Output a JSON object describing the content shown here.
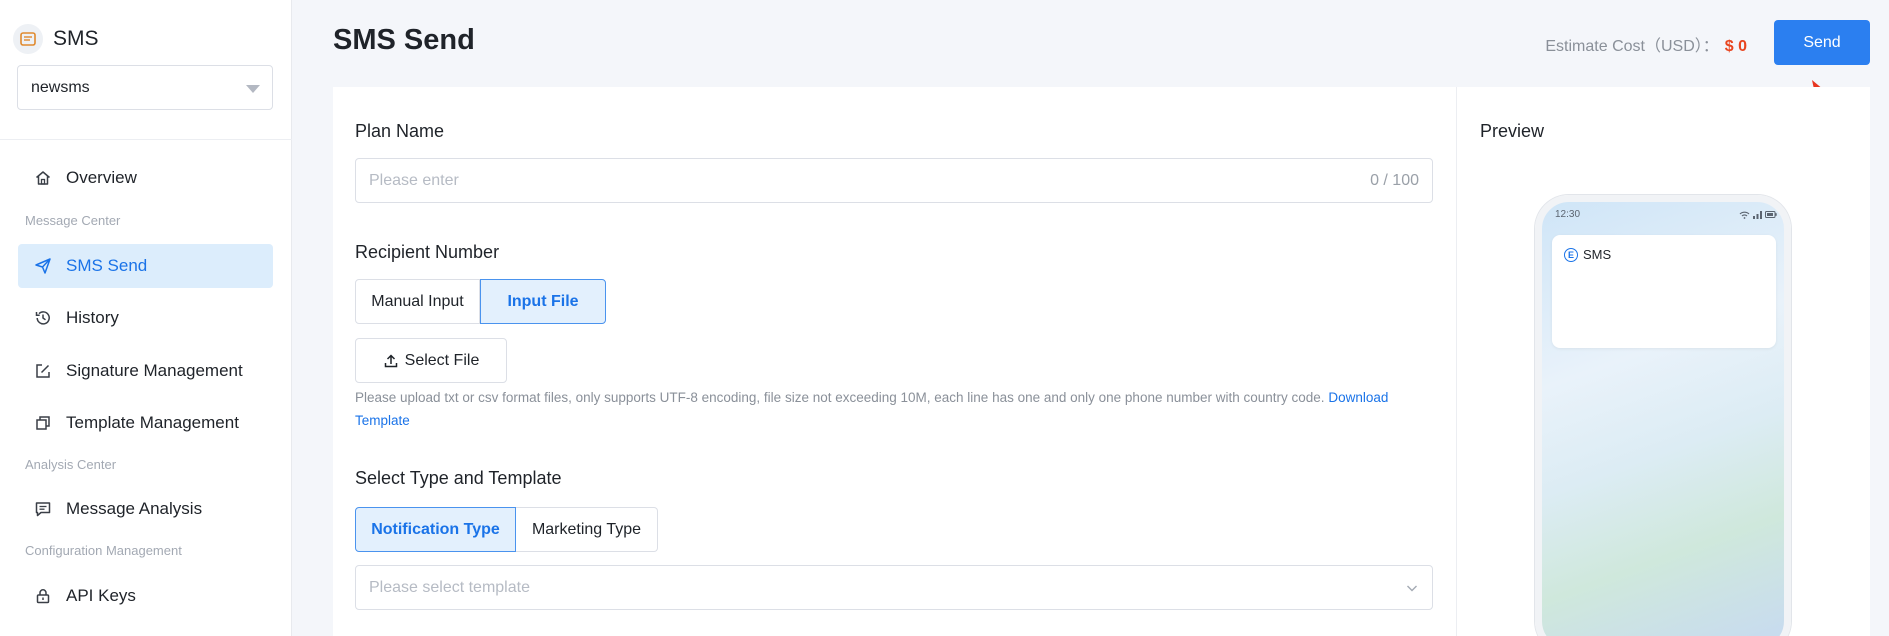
{
  "brand": {
    "title": "SMS"
  },
  "app_select": {
    "value": "newsms"
  },
  "nav": {
    "overview": "Overview",
    "section_message": "Message Center",
    "sms_send": "SMS Send",
    "history": "History",
    "signature": "Signature Management",
    "template": "Template Management",
    "section_analysis": "Analysis Center",
    "message_analysis": "Message Analysis",
    "section_config": "Configuration Management",
    "api_keys": "API Keys"
  },
  "header": {
    "title": "SMS Send",
    "cost_label": "Estimate Cost（USD）：",
    "cost_value": "$ 0",
    "send_label": "Send"
  },
  "form": {
    "plan_name_label": "Plan Name",
    "plan_name_placeholder": "Please enter",
    "plan_name_count": "0 / 100",
    "recipient_label": "Recipient Number",
    "recipient_tabs": [
      "Manual Input",
      "Input File"
    ],
    "recipient_active": "Input File",
    "select_file_label": "Select File",
    "help_text": "Please upload txt or csv format files, only supports UTF-8 encoding, file size not exceeding 10M, each line has one and only one phone number with country code.",
    "download_template": "Download Template",
    "type_label": "Select Type and Template",
    "type_tabs": [
      "Notification Type",
      "Marketing Type"
    ],
    "type_active": "Notification Type",
    "template_placeholder": "Please select template"
  },
  "preview": {
    "title": "Preview",
    "phone_time": "12:30",
    "message_sender": "SMS"
  },
  "colors": {
    "primary": "#2b7ff0",
    "active_bg": "#dcedfc",
    "cost_value": "#e8451f",
    "arrow": "#e8351f"
  }
}
